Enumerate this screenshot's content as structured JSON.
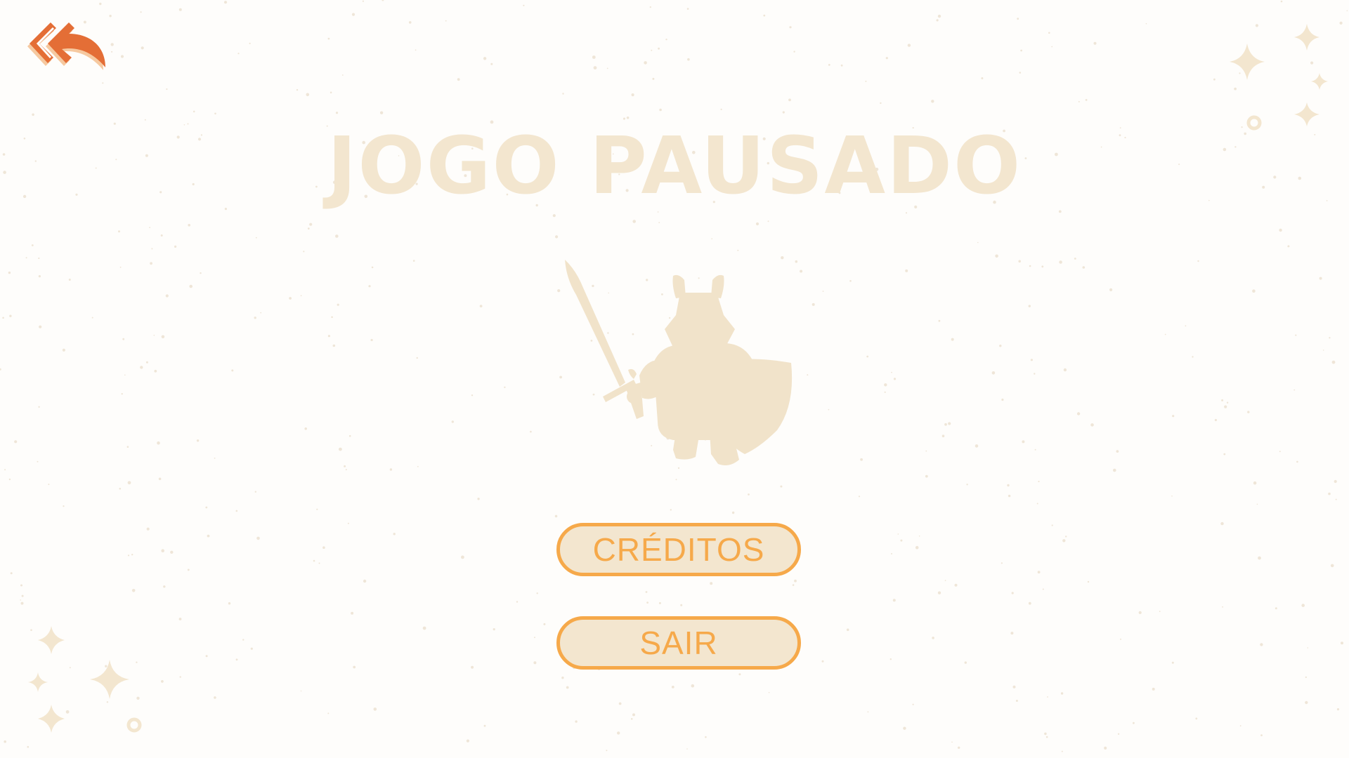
{
  "screen": {
    "title": "JOGO PAUSADO"
  },
  "menu": {
    "credits_label": "CRÉDITOS",
    "exit_label": "SAIR"
  },
  "icons": {
    "back": "double-arrow-back-icon",
    "character": "knight-silhouette",
    "decoration": "sparkle-stars"
  },
  "colors": {
    "background": "#fefdfb",
    "title": "#f3e6cf",
    "silhouette": "#f1e3ca",
    "button_fill": "#f3e6cf",
    "button_border": "#f6a94a",
    "button_text": "#f6a94a",
    "back_icon": "#e46e36",
    "back_icon_shadow": "#f6c9a0",
    "sparkle": "#f3e6cf"
  }
}
